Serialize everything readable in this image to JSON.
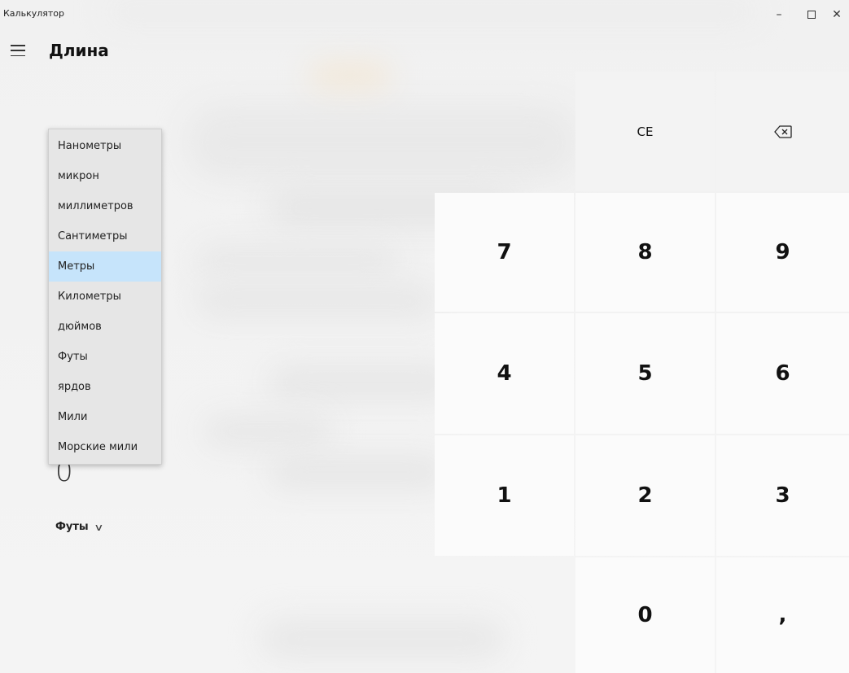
{
  "window": {
    "title": "Калькулятор"
  },
  "header": {
    "title": "Длина"
  },
  "converter": {
    "value": "0",
    "unit": "Футы"
  },
  "dropdown": {
    "items": [
      {
        "label": "Нанометры"
      },
      {
        "label": "микрон"
      },
      {
        "label": "миллиметров"
      },
      {
        "label": "Сантиметры"
      },
      {
        "label": "Метры",
        "selected": true
      },
      {
        "label": "Километры"
      },
      {
        "label": "дюймов"
      },
      {
        "label": "Футы"
      },
      {
        "label": "ярдов"
      },
      {
        "label": "Мили"
      },
      {
        "label": "Морские мили"
      }
    ]
  },
  "keypad": {
    "ce": "CE",
    "k7": "7",
    "k8": "8",
    "k9": "9",
    "k4": "4",
    "k5": "5",
    "k6": "6",
    "k1": "1",
    "k2": "2",
    "k3": "3",
    "k0": "0",
    "decimal": ","
  },
  "icons": {
    "menu": "hamburger-icon",
    "backspace": "backspace-icon",
    "chevron": "chevron-down-icon",
    "minimize": "minimize-icon",
    "maximize": "maximize-icon",
    "close": "close-icon"
  },
  "colors": {
    "selection": "#c6e4fb",
    "key_light": "#f3f3f3",
    "key_white": "#fbfbfb"
  }
}
